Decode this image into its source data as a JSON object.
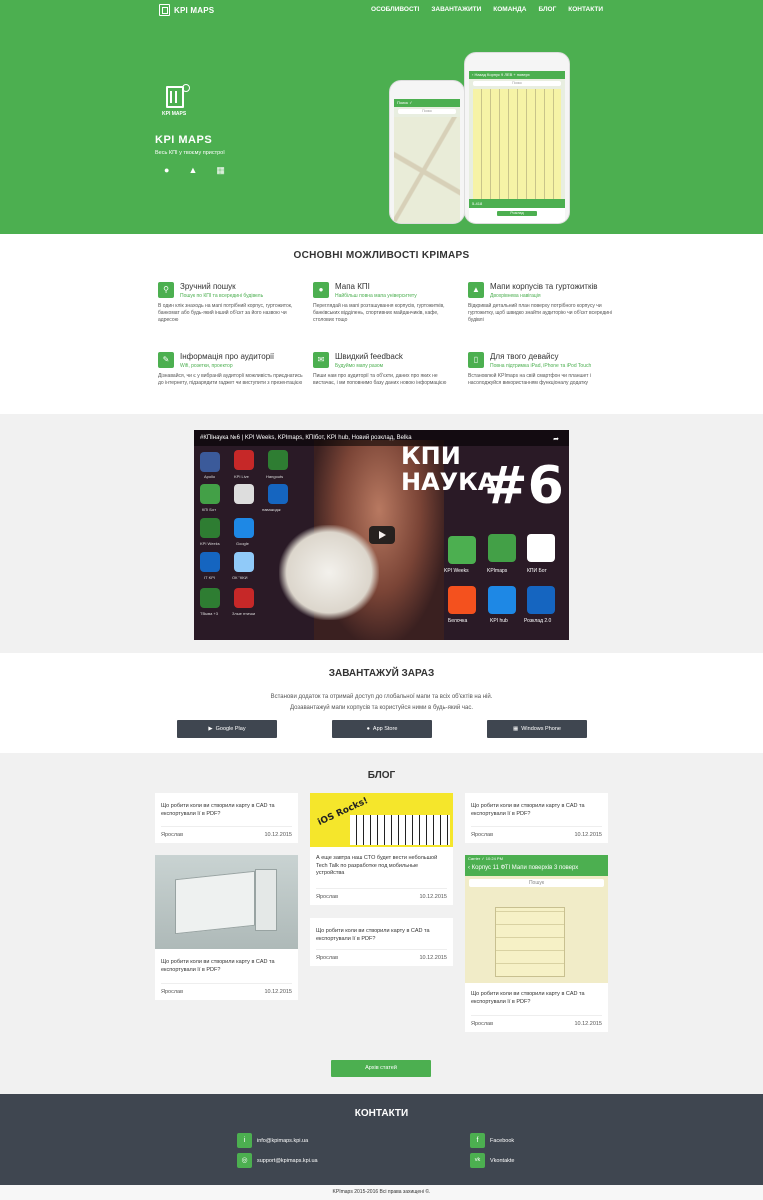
{
  "nav": {
    "brand": "KPI MAPS",
    "links": [
      "ОСОБЛИВОСТІ",
      "ЗАВАНТАЖИТИ",
      "КОМАНДА",
      "БЛОГ",
      "КОНТАКТИ"
    ]
  },
  "hero": {
    "logo_caption": "KPI MAPS",
    "title": "KPI MAPS",
    "subtitle": "Весь КПІ у твоєму пристрої",
    "store_icons": [
      "apple-icon",
      "android-icon",
      "windows-icon"
    ],
    "phone_back": {
      "status": "Поиск ✓",
      "search": "Поиск"
    },
    "phone_front": {
      "bar": "‹ Назад  Корпус 9 ЛЕВ   + поверх",
      "search": "Поиск",
      "room": "5-418",
      "button": "Розклад"
    }
  },
  "features": {
    "title": "ОСНОВНІ МОЖЛИВОСТІ KPIMAPS",
    "items": [
      {
        "icon": "search-icon",
        "title": "Зручний пошук",
        "subtitle": "Пошук по КПІ та всередині будівель",
        "desc": "В один клік знаходь на мапі потрібний корпус, гуртожиток, банкомат або будь-який інший об'єкт за його назвою чи адресою"
      },
      {
        "icon": "map-pin-icon",
        "title": "Мапа КПІ",
        "subtitle": "Найбільш повна мапа університету",
        "desc": "Переглядай на мапі розташування корпусів, гуртожитків, банківських відділень, спортивних майданчиків, кафе, столових тощо"
      },
      {
        "icon": "graduation-cap-icon",
        "title": "Мапи корпусів та гуртожитків",
        "subtitle": "Двохрівнева навігація",
        "desc": "Відкривай детальний план поверху потрібного корпусу чи гуртожитку, щоб швидко знайти аудиторію чи об'єкт всередині будівлі"
      },
      {
        "icon": "chat-icon",
        "title": "Інформація про аудиторії",
        "subtitle": "Wifi, розетки, проектор",
        "desc": "Дізнавайся, чи є у вибраній аудиторії можливість приєднатись до інтернету, підзарядити гаджет чи виступити з презентацією"
      },
      {
        "icon": "feedback-icon",
        "title": "Швидкий feedback",
        "subtitle": "Будуймо мапу разом",
        "desc": "Пиши нам про аудиторії та об'єкти, даних про яких не вистачає, і ми поповнимо базу даних новою інформацією"
      },
      {
        "icon": "device-icon",
        "title": "Для твого девайсу",
        "subtitle": "Повна підтримка iPad, iPhone та iPod Touch",
        "desc": "Встановлюй KPImaps на свій смартфон чи планшет і насолоджуйся використанням функціоналу додатку"
      }
    ]
  },
  "video": {
    "title": "#КПІнаука №6 | KPI Weeks, KPImaps, КПІбот, KPI hub, Новий розклад, Belka",
    "overlay_line1": "КПИ",
    "overlay_line2": "НАУКА",
    "overlay_number": "#6",
    "left_apps": [
      "Apollo",
      "KPI Live",
      "Hangouts",
      "КПІ Бот",
      "",
      "наважодж",
      "KPI Weeks",
      "Google",
      "IT KPI",
      "ОК \"ККИ",
      "ТВыва +3",
      "Злые птички"
    ],
    "right_apps": [
      "KPI Weeks",
      "KPImaps",
      "КПИ Бот",
      "Белочка",
      "KPI hub",
      "Розклад 2.0"
    ]
  },
  "download": {
    "title": "ЗАВАНТАЖУЙ ЗАРАЗ",
    "line1": "Встанови додаток та отримай доступ до глобальної мапи та всіх об'єктів на ній.",
    "line2": "Дозавантажуй мапи корпусів та користуйся ними в будь-який час.",
    "buttons": [
      "Google Play",
      "App Store",
      "Windows Phone"
    ]
  },
  "blog": {
    "title": "БЛОГ",
    "cards": [
      {
        "text": "Що робити коли ви створили карту в CAD та експортували її в PDF?",
        "author": "Ярослав",
        "date": "10.12.2015"
      },
      {
        "text": "А еще завтра наш CTO будет вести небольшой Tech Talk по разработке под мобильные устройства",
        "author": "Ярослав",
        "date": "10.12.2015",
        "image_text": "iOS Rocks!"
      },
      {
        "text": "Що робити коли ви створили карту в CAD та експортували її в PDF?",
        "author": "Ярослав",
        "date": "10.12.2015"
      },
      {
        "text": "Що робити коли ви створили карту в CAD та експортували її в PDF?",
        "author": "Ярослав",
        "date": "10.12.2015"
      },
      {
        "text": "Що робити коли ви створили карту в CAD та експортували її в PDF?",
        "author": "Ярослав",
        "date": "10.12.2015"
      },
      {
        "text": "Що робити коли ви створили карту в CAD та експортували її в PDF?",
        "author": "Ярослав",
        "date": "10.12.2015",
        "image_status": "Carrier ✓   10:24 PM",
        "image_bar": "‹ Корпус 11 ФТІ  Мапи поверхів   3 поверх",
        "image_search": "Пошук"
      }
    ],
    "archive": "Архів статей"
  },
  "contacts": {
    "title": "КОНТАКТИ",
    "items": [
      {
        "icon": "info-icon",
        "text": "info@kpimaps.kpi.ua"
      },
      {
        "icon": "support-icon",
        "text": "support@kpimaps.kpi.ua"
      },
      {
        "icon": "facebook-icon",
        "text": "Facebook"
      },
      {
        "icon": "vkontakte-icon",
        "text": "Vkontakte"
      }
    ]
  },
  "footer": {
    "copyright": "KPImaps 2015-2016 Всі права захищені ©."
  },
  "colors": {
    "accent": "#4caf50",
    "dark": "#3f4650",
    "light_band": "#f1f1f1"
  }
}
